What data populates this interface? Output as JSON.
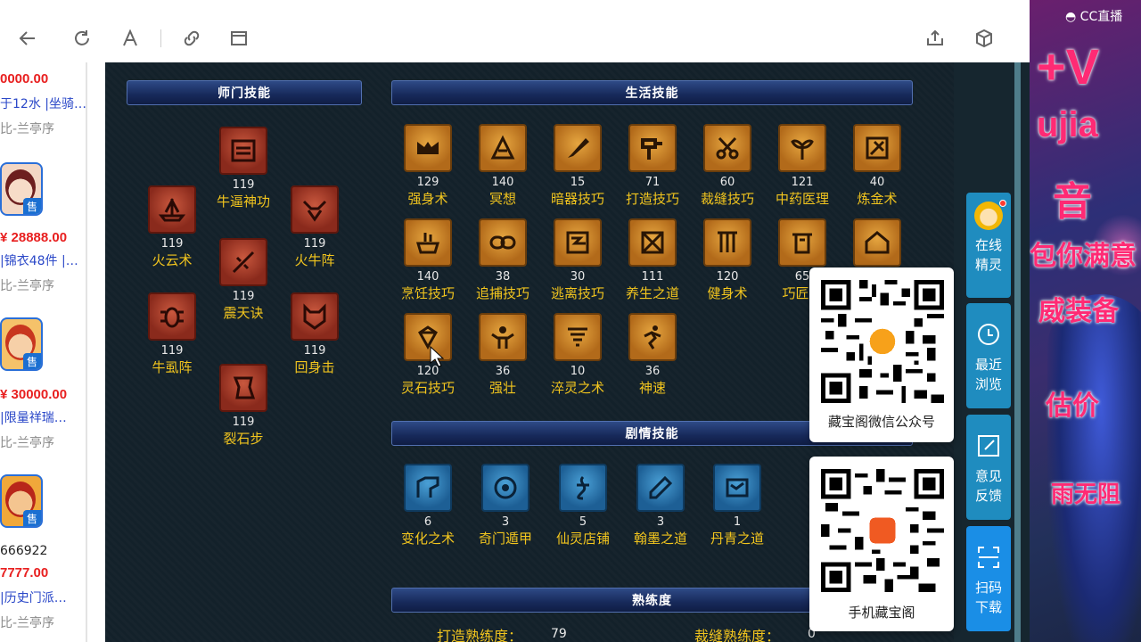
{
  "listings": [
    {
      "price": "0000.00",
      "tagline": "于12水 |坐骑…",
      "seller": "比-兰亭序"
    },
    {
      "price": "¥ 28888.00",
      "tagline": "|锦衣48件 |…",
      "seller": "比-兰亭序",
      "badge": "售"
    },
    {
      "price": "¥ 30000.00",
      "tagline": "|限量祥瑞…",
      "seller": "比-兰亭序",
      "badge": "售"
    },
    {
      "price": "7777.00",
      "id_text": "666922",
      "tagline": "|历史门派…",
      "seller": "比-兰亭序",
      "badge": "售"
    }
  ],
  "panel": {
    "sections": {
      "shimen": "师门技能",
      "shenghuo": "生活技能",
      "juqing": "剧情技能",
      "shulian": "熟练度"
    },
    "shimen_skills": [
      {
        "name": "牛逼神功",
        "level": "119"
      },
      {
        "name": "火云术",
        "level": "119"
      },
      {
        "name": "火牛阵",
        "level": "119"
      },
      {
        "name": "震天诀",
        "level": "119"
      },
      {
        "name": "牛虱阵",
        "level": "119"
      },
      {
        "name": "回身击",
        "level": "119"
      },
      {
        "name": "裂石步",
        "level": "119"
      }
    ],
    "life_skills": [
      {
        "name": "强身术",
        "level": "129"
      },
      {
        "name": "冥想",
        "level": "140"
      },
      {
        "name": "暗器技巧",
        "level": "15"
      },
      {
        "name": "打造技巧",
        "level": "71"
      },
      {
        "name": "裁缝技巧",
        "level": "60"
      },
      {
        "name": "中药医理",
        "level": "121"
      },
      {
        "name": "炼金术",
        "level": "40"
      },
      {
        "name": "烹饪技巧",
        "level": "140"
      },
      {
        "name": "追捕技巧",
        "level": "38"
      },
      {
        "name": "逃离技巧",
        "level": "30"
      },
      {
        "name": "养生之道",
        "level": "111"
      },
      {
        "name": "健身术",
        "level": "120"
      },
      {
        "name": "巧匠之",
        "level": "65"
      },
      {
        "name": "",
        "level": ""
      },
      {
        "name": "灵石技巧",
        "level": "120"
      },
      {
        "name": "强壮",
        "level": "36"
      },
      {
        "name": "淬灵之术",
        "level": "10"
      },
      {
        "name": "神速",
        "level": "36"
      }
    ],
    "story_skills": [
      {
        "name": "变化之术",
        "level": "6"
      },
      {
        "name": "奇门遁甲",
        "level": "3"
      },
      {
        "name": "仙灵店铺",
        "level": "5"
      },
      {
        "name": "翰墨之道",
        "level": "3"
      },
      {
        "name": "丹青之道",
        "level": "1"
      }
    ],
    "proficiency": [
      {
        "label": "打造熟练度：",
        "value": "79"
      },
      {
        "label": "裁缝熟练度：",
        "value": "0"
      }
    ]
  },
  "qr_cards": [
    {
      "label": "藏宝阁微信公众号"
    },
    {
      "label": "手机藏宝阁"
    }
  ],
  "side_buttons": [
    {
      "label": "在线精灵",
      "line1": "在线",
      "line2": "精灵"
    },
    {
      "label": "最近浏览",
      "line1": "最近",
      "line2": "浏览"
    },
    {
      "label": "意见反馈",
      "line1": "意见",
      "line2": "反馈"
    },
    {
      "label": "扫码下载",
      "line1": "扫码",
      "line2": "下载"
    }
  ],
  "stream": {
    "watermark": "CC直播",
    "lines": [
      "+V",
      "ujia",
      "音",
      "包你满意",
      "威装备",
      "估价",
      "雨无阻"
    ]
  },
  "colors": {
    "panel_bg": "#13212a",
    "skill_name": "#f2c51e",
    "price": "#e81f1f",
    "side_button": "#1f8cbf"
  }
}
